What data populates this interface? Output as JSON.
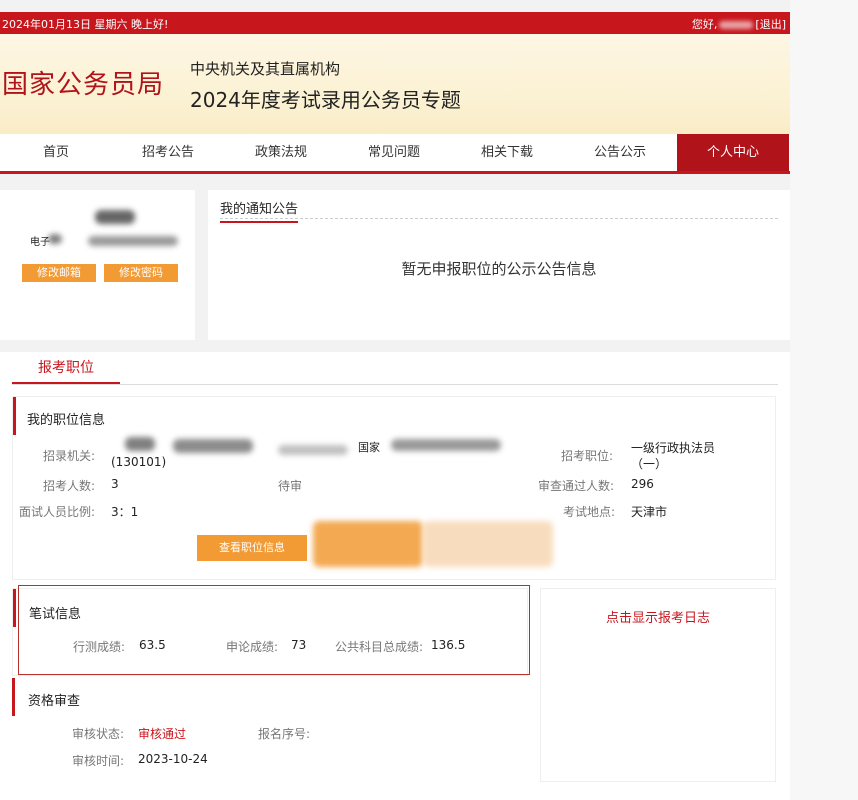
{
  "topbar": {
    "date_text": "2024年01月13日   星期六   晚上好!",
    "greeting": "您好,",
    "logout": "[退出]"
  },
  "banner": {
    "title": "国家公务员局",
    "subtitle1": "中央机关及其直属机构",
    "subtitle2": "2024年度考试录用公务员专题"
  },
  "nav": {
    "items": [
      "首页",
      "招考公告",
      "政策法规",
      "常见问题",
      "相关下载",
      "公告公示",
      "个人中心"
    ],
    "active": "个人中心"
  },
  "profile": {
    "email_prefix": "电子",
    "change_email": "修改邮箱",
    "change_password": "修改密码"
  },
  "notice": {
    "heading": "我的通知公告",
    "empty_message": "暂无申报职位的公示公告信息"
  },
  "registration": {
    "tab": "报考职位"
  },
  "position": {
    "title": "我的职位信息",
    "agency_label": "招录机关:",
    "agency_code": "(130101)",
    "agency_partial": "国家",
    "post_label": "招考职位:",
    "post_line1": "一级行政执法员",
    "post_line2": "（一）",
    "count_label": "招考人数:",
    "count_value": "3",
    "pending_partial": "待审",
    "approved_label": "审查通过人数:",
    "approved_value": "296",
    "ratio_label": "面试人员比例:",
    "ratio_value": "3：1",
    "location_label": "考试地点:",
    "location_value": "天津市",
    "view_button": "查看职位信息"
  },
  "written_exam": {
    "title": "笔试信息",
    "xingce_label": "行测成绩:",
    "xingce_value": "63.5",
    "shenlun_label": "申论成绩:",
    "shenlun_value": "73",
    "total_label": "公共科目总成绩:",
    "total_value": "136.5"
  },
  "qualification": {
    "title": "资格审查",
    "status_label": "审核状态:",
    "status_value": "审核通过",
    "seq_label": "报名序号:",
    "time_label": "审核时间:",
    "time_value": "2023-10-24"
  },
  "log": {
    "link": "点击显示报考日志"
  },
  "colors": {
    "brand_red": "#c8161d",
    "orange": "#f29a33",
    "banner_bg": "#fbf1d2"
  }
}
